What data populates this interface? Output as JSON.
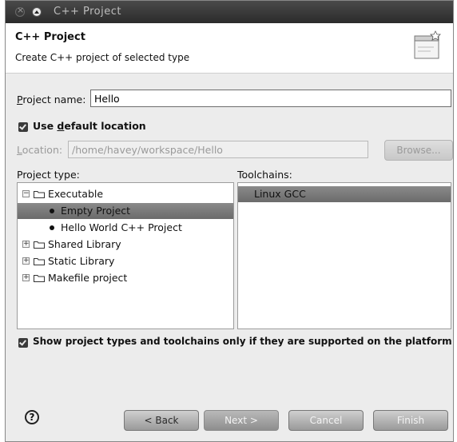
{
  "window": {
    "title": "C++ Project"
  },
  "header": {
    "title": "C++ Project",
    "subtitle": "Create C++ project of selected type",
    "icon": "new-project-wizard-icon"
  },
  "project_name": {
    "label_prefix": "",
    "label_mnemonic": "P",
    "label_rest": "roject name:",
    "value": "Hello"
  },
  "default_location": {
    "label_prefix": "Use ",
    "label_mnemonic": "d",
    "label_rest": "efault location",
    "checked": true
  },
  "location": {
    "label_mnemonic": "L",
    "label_rest": "ocation:",
    "value": "/home/havey/workspace/Hello",
    "browse_label": "Browse...",
    "enabled": false
  },
  "project_type": {
    "label": "Project type:",
    "items": [
      {
        "label": "Executable",
        "kind": "folder",
        "expander": "−",
        "selected": false
      },
      {
        "label": "Empty Project",
        "kind": "leaf",
        "expander": "",
        "selected": true
      },
      {
        "label": "Hello World C++ Project",
        "kind": "leaf",
        "expander": "",
        "selected": false
      },
      {
        "label": "Shared Library",
        "kind": "folder",
        "expander": "+",
        "selected": false
      },
      {
        "label": "Static Library",
        "kind": "folder",
        "expander": "+",
        "selected": false
      },
      {
        "label": "Makefile project",
        "kind": "folder",
        "expander": "+",
        "selected": false
      }
    ]
  },
  "toolchains": {
    "label": "Toolchains:",
    "items": [
      {
        "label": "Linux GCC",
        "selected": true
      }
    ]
  },
  "filter_option": {
    "label": "Show project types and toolchains only if they are supported on the platform",
    "checked": true
  },
  "footer": {
    "help_label": "?",
    "back_label": "< Back",
    "next_label": "Next >",
    "cancel_label": "Cancel",
    "finish_label": "Finish"
  }
}
